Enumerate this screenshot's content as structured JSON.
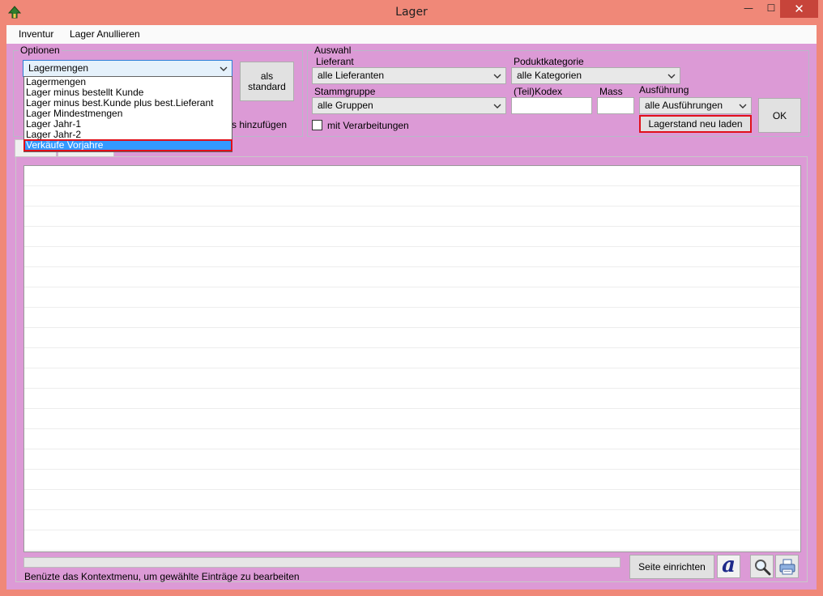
{
  "window": {
    "title": "Lager",
    "minimize": "—",
    "maximize": "☐",
    "close": "✕"
  },
  "menu": {
    "items": [
      "Inventur",
      "Lager Anullieren"
    ]
  },
  "optionen": {
    "legend": "Optionen",
    "combo_value": "Lagermengen",
    "als_standard": "als\nstandard",
    "hidden_label_tail": "s hinzufügen",
    "dropdown_options": [
      "Lagermengen",
      "Lager minus bestellt Kunde",
      "Lager minus best.Kunde plus best.Lieferant",
      "Lager Mindestmengen",
      "Lager Jahr-1",
      "Lager Jahr-2",
      "Verkäufe Vorjahre"
    ],
    "selected_index": 6
  },
  "auswahl": {
    "legend": "Auswahl",
    "lieferant_label": "Lieferant",
    "lieferant_value": "alle Lieferanten",
    "kategorie_label": "Poduktkategorie",
    "kategorie_value": "alle Kategorien",
    "stammgruppe_label": "Stammgruppe",
    "stammgruppe_value": "alle Gruppen",
    "kodex_label": "(Teil)Kodex",
    "kodex_value": "",
    "mass_label": "Mass",
    "mass_value": "",
    "ausfuehrung_label": "Ausführung",
    "ausfuehrung_value": "alle Ausführungen",
    "verarbeitungen_label": "mit Verarbeitungen",
    "verarbeitungen_checked": false,
    "reload_button": "Lagerstand neu laden",
    "ok_button": "OK"
  },
  "bottom": {
    "status": "Benüzte das Kontextmenu, um gewählte Einträge zu bearbeiten",
    "seite_einrichten": "Seite einrichten",
    "font_icon_glyph": "a",
    "progress": 0
  },
  "colors": {
    "client_bg": "#dc9ad6",
    "window_bg": "#f08878",
    "selection": "#3399ff",
    "highlight_border": "#e0101a"
  }
}
